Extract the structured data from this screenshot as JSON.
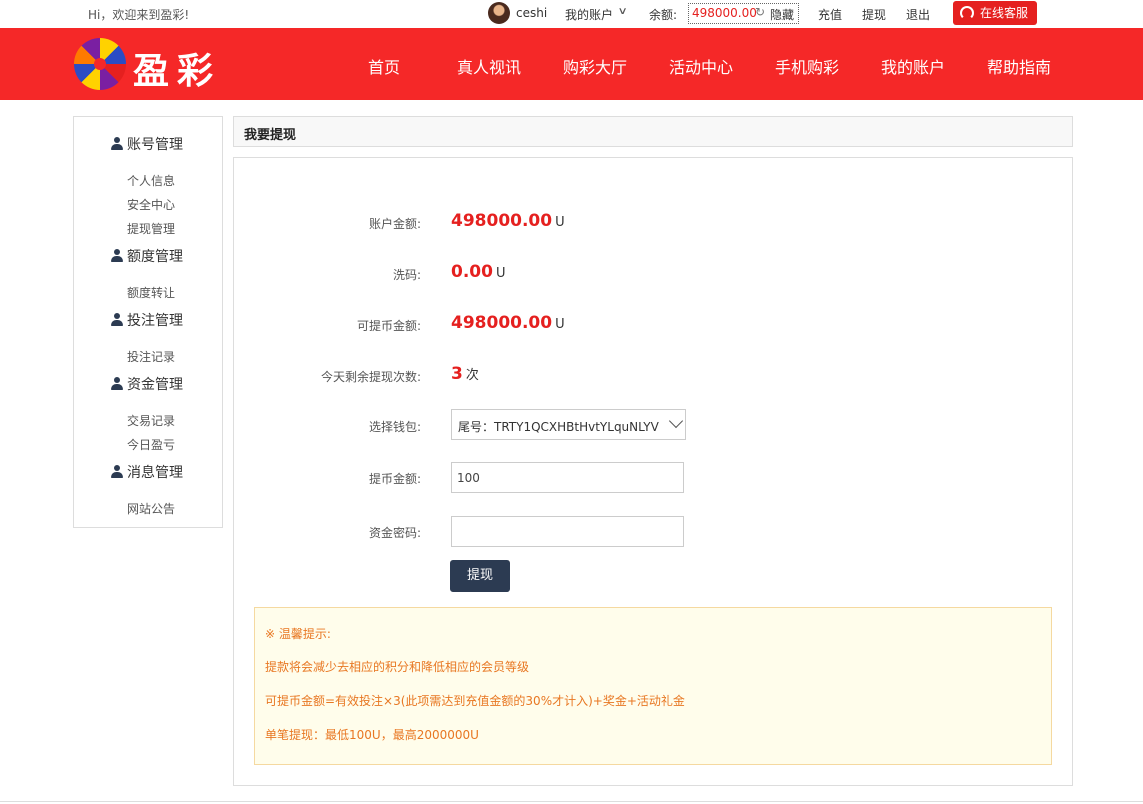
{
  "topbar": {
    "greeting": "Hi，欢迎来到盈彩!",
    "username": "ceshi",
    "my_account": "我的账户",
    "balance_label": "余额:",
    "balance_value": "498000.00",
    "hide_label": "隐藏",
    "recharge": "充值",
    "withdraw": "提现",
    "logout": "退出",
    "service_button": "在线客服"
  },
  "header": {
    "logo_text": "盈彩",
    "nav": [
      "首页",
      "真人视讯",
      "购彩大厅",
      "活动中心",
      "手机购彩",
      "我的账户",
      "帮助指南"
    ]
  },
  "sidebar": {
    "groups": [
      {
        "title": "账号管理",
        "items": [
          "个人信息",
          "安全中心",
          "提现管理"
        ]
      },
      {
        "title": "额度管理",
        "items": [
          "额度转让"
        ]
      },
      {
        "title": "投注管理",
        "items": [
          "投注记录"
        ]
      },
      {
        "title": "资金管理",
        "items": [
          "交易记录",
          "今日盈亏"
        ]
      },
      {
        "title": "消息管理",
        "items": [
          "网站公告"
        ]
      }
    ]
  },
  "main": {
    "title": "我要提现",
    "account_amount_label": "账户金额:",
    "account_amount": "498000.00",
    "wash_label": "洗码:",
    "wash_amount": "0.00",
    "withdrawable_label": "可提币金额:",
    "withdrawable_amount": "498000.00",
    "unit": "U",
    "remaining_label": "今天剩余提现次数:",
    "remaining_count": "3",
    "remaining_unit": "次",
    "wallet_label": "选择钱包:",
    "wallet_selected": "尾号：TRTY1QCXHBtHvtYLquNLYV",
    "amount_label": "提币金额:",
    "amount_value": "100",
    "password_label": "资金密码:",
    "password_value": "",
    "submit_label": "提现"
  },
  "tips": {
    "title": "※ 温馨提示:",
    "lines": [
      "提款将会减少去相应的积分和降低相应的会员等级",
      "可提币金额=有效投注×3(此项需达到充值金额的30%才计入)+奖金+活动礼金",
      "单笔提现：最低100U，最高2000000U"
    ]
  },
  "colors": {
    "brand_red": "#f52828",
    "amount_red": "#e5201f",
    "button_navy": "#2c3b52",
    "tip_orange": "#e87722"
  },
  "icons": [
    "refresh-icon",
    "headset-icon",
    "chevron-down-icon",
    "user-icon",
    "logo-icon"
  ]
}
